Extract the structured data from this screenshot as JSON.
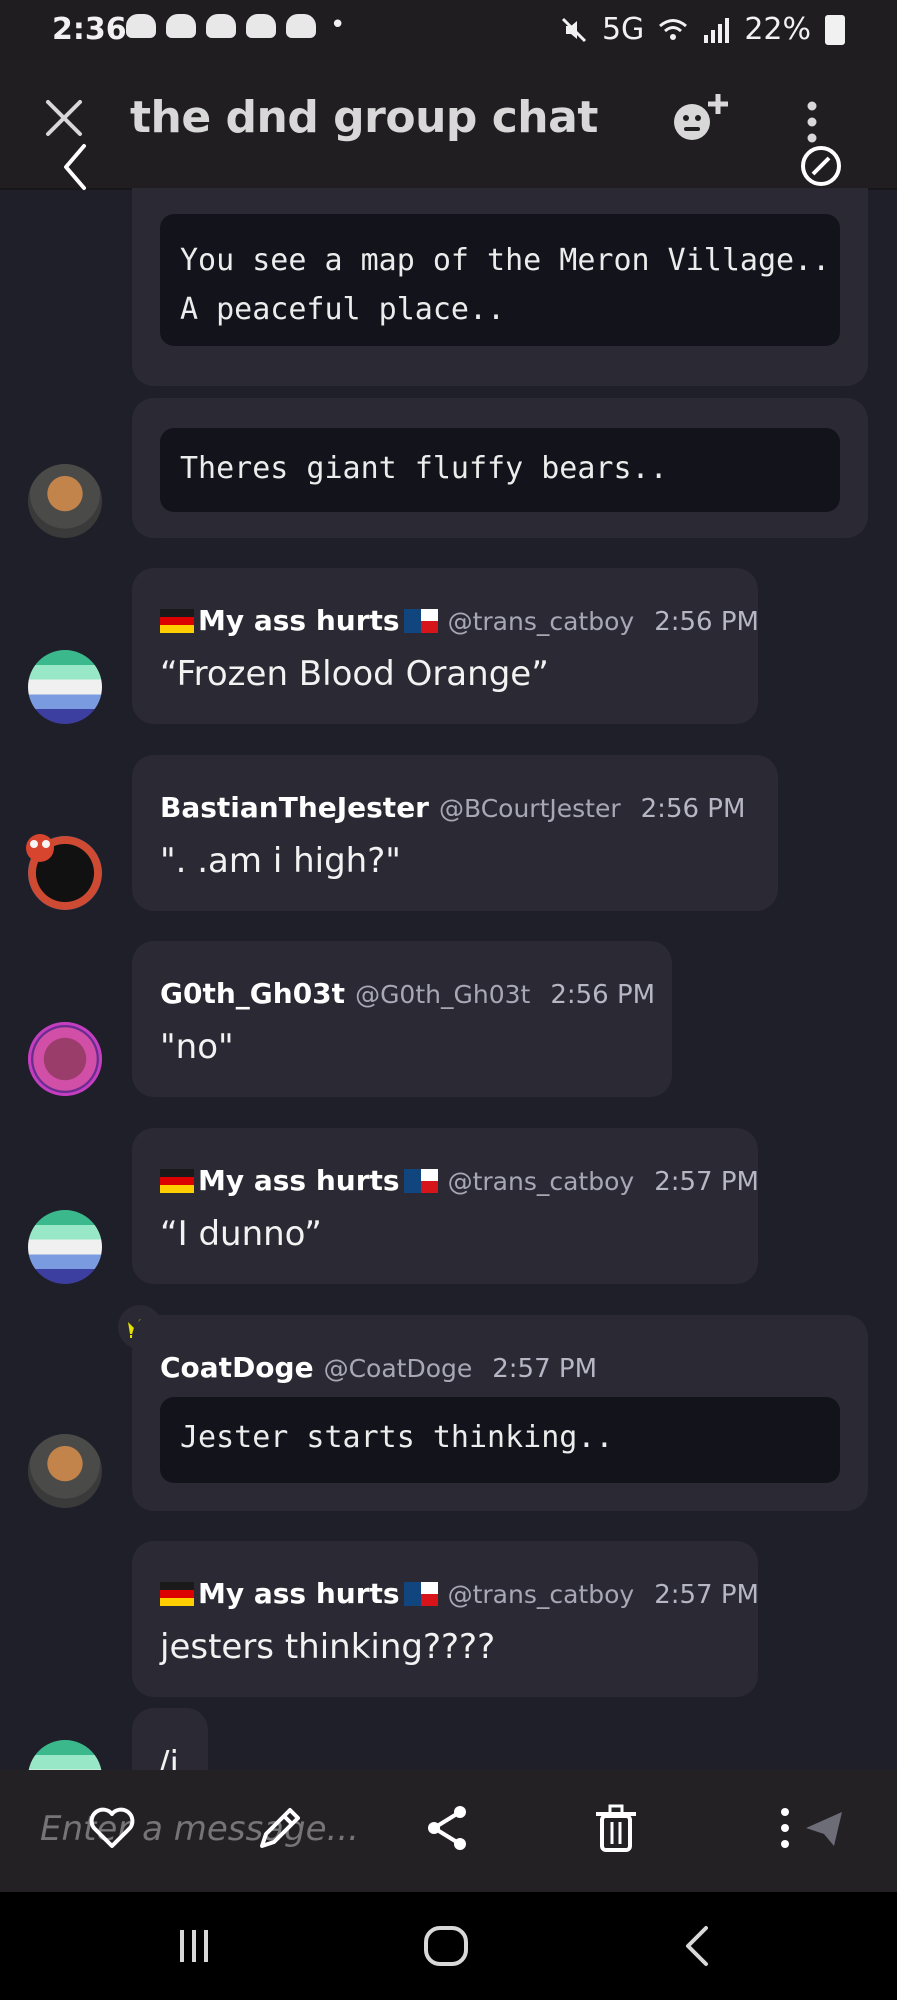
{
  "status_bar": {
    "time": "2:36",
    "signal_text": "5G",
    "battery": "22%"
  },
  "header": {
    "title": "the dnd group chat",
    "icons": [
      "close-icon",
      "back-icon",
      "add-emoji-icon",
      "more-icon",
      "sync-icon"
    ]
  },
  "messages": [
    {
      "type": "code_only",
      "body": "You see a map of the Meron Village..\nA peaceful place.."
    },
    {
      "type": "code_only",
      "body": "Theres giant fluffy bears.."
    },
    {
      "author": "My ass hurts",
      "handle": "@trans_catboy",
      "time": "2:56 PM",
      "body": "“Frozen Blood Orange”"
    },
    {
      "author": "BastianTheJester",
      "handle": "@BCourtJester",
      "time": "2:56 PM",
      "body": "\". .am i high?\""
    },
    {
      "author": "G0th_Gh03t",
      "handle": "@G0th_Gh03t",
      "time": "2:56 PM",
      "body": "\"no\""
    },
    {
      "author": "My ass hurts",
      "handle": "@trans_catboy",
      "time": "2:57 PM",
      "body": "“I dunno”"
    },
    {
      "author": "CoatDoge",
      "handle": "@CoatDoge",
      "time": "2:57 PM",
      "body": "Jester starts thinking.."
    },
    {
      "author": "My ass hurts",
      "handle": "@trans_catboy",
      "time": "2:57 PM",
      "body": "jesters thinking????"
    },
    {
      "body": "/i"
    }
  ],
  "composer": {
    "placeholder": "Enter a message...",
    "icons": [
      "heart-icon",
      "edit-icon",
      "share-icon",
      "trash-icon",
      "more-vertical-icon",
      "send-icon"
    ]
  },
  "navigation": {
    "icons": [
      "recent-apps-icon",
      "home-icon",
      "back-nav-icon"
    ]
  },
  "colors": {
    "background": "#1f1f2a",
    "bubble": "#2b2a34",
    "code_block": "#13131c",
    "crown": "#e8e000"
  }
}
